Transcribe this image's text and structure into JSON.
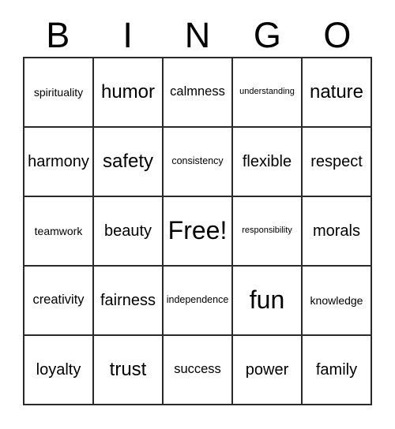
{
  "card": {
    "title": "BINGO",
    "header_letters": [
      "B",
      "I",
      "N",
      "G",
      "O"
    ],
    "free_space_label": "Free!",
    "grid_size": "5x5",
    "colors": {
      "background": "#ffffff",
      "text": "#000000",
      "border": "#2b2b2b"
    },
    "rows": [
      {
        "cells": [
          {
            "text": "spirituality",
            "size": "md"
          },
          {
            "text": "humor",
            "size": "xxl"
          },
          {
            "text": "calmness",
            "size": "lg"
          },
          {
            "text": "understanding",
            "size": "xs"
          },
          {
            "text": "nature",
            "size": "xxl"
          }
        ]
      },
      {
        "cells": [
          {
            "text": "harmony",
            "size": "xl"
          },
          {
            "text": "safety",
            "size": "xxl"
          },
          {
            "text": "consistency",
            "size": "sm"
          },
          {
            "text": "flexible",
            "size": "xl"
          },
          {
            "text": "respect",
            "size": "xl"
          }
        ]
      },
      {
        "cells": [
          {
            "text": "teamwork",
            "size": "md"
          },
          {
            "text": "beauty",
            "size": "xl"
          },
          {
            "text": "Free!",
            "size": "huge"
          },
          {
            "text": "responsibility",
            "size": "xs"
          },
          {
            "text": "morals",
            "size": "xl"
          }
        ]
      },
      {
        "cells": [
          {
            "text": "creativity",
            "size": "lg"
          },
          {
            "text": "fairness",
            "size": "xl"
          },
          {
            "text": "independence",
            "size": "sm"
          },
          {
            "text": "fun",
            "size": "huge"
          },
          {
            "text": "knowledge",
            "size": "md"
          }
        ]
      },
      {
        "cells": [
          {
            "text": "loyalty",
            "size": "xl"
          },
          {
            "text": "trust",
            "size": "xxl"
          },
          {
            "text": "success",
            "size": "lg"
          },
          {
            "text": "power",
            "size": "xl"
          },
          {
            "text": "family",
            "size": "xl"
          }
        ]
      }
    ]
  }
}
